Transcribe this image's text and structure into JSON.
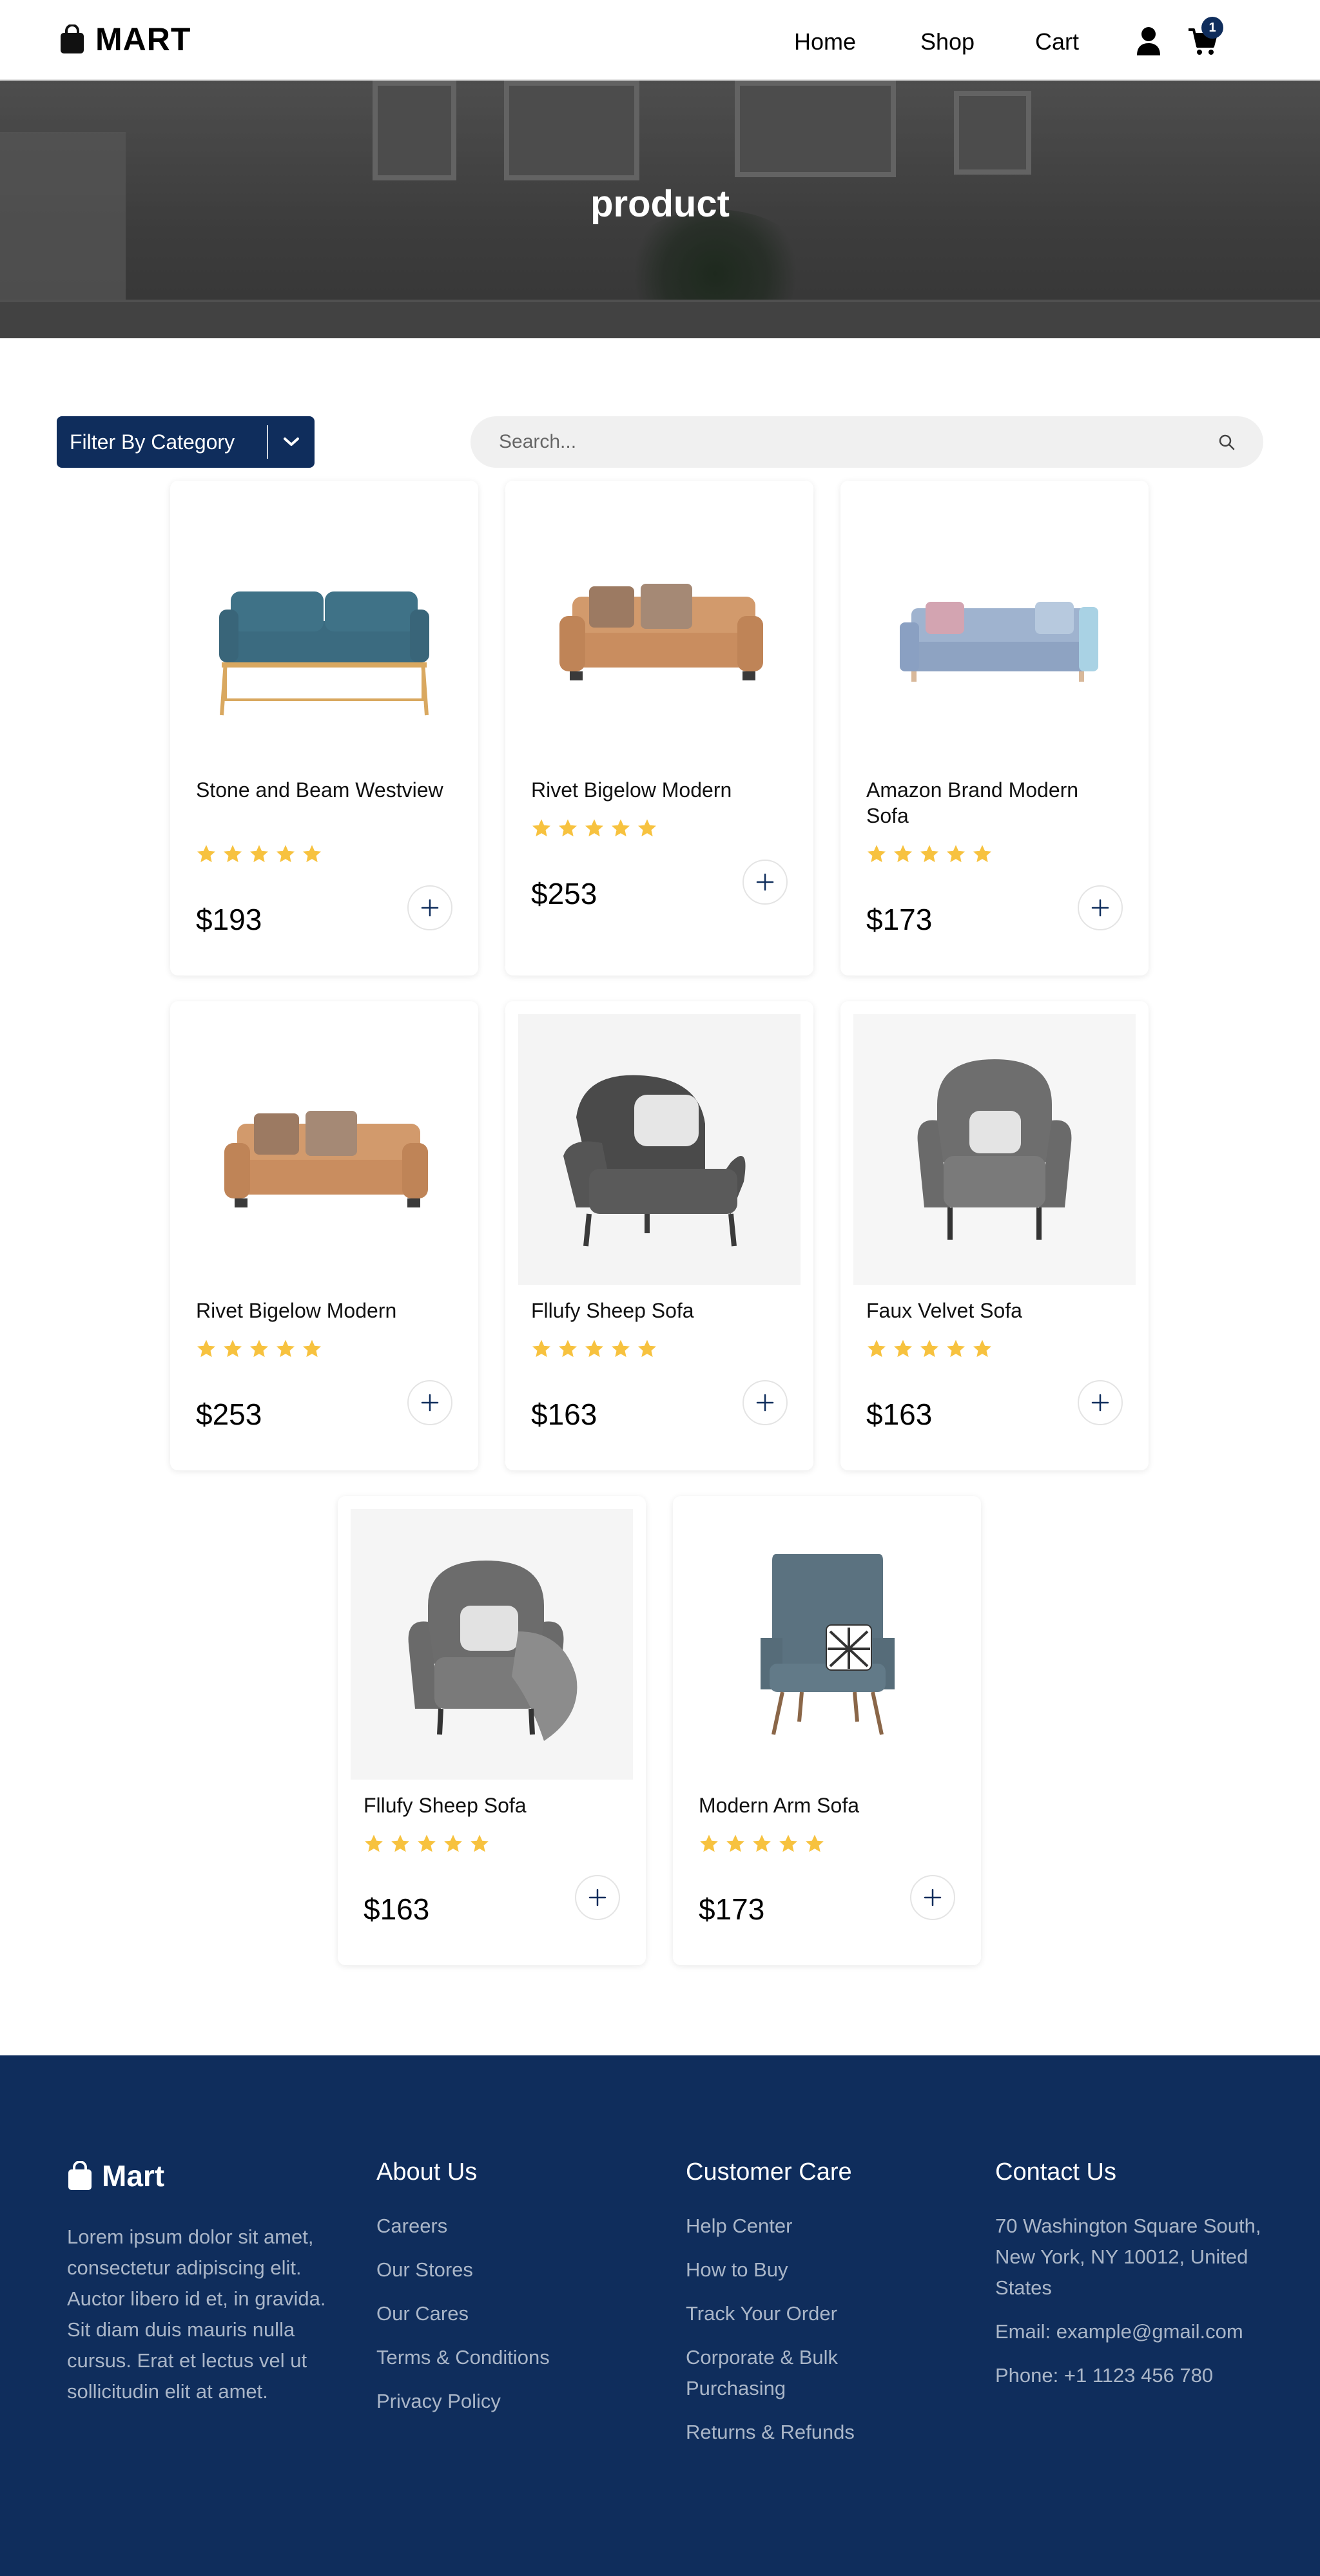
{
  "header": {
    "brand": "MART",
    "nav": {
      "home": "Home",
      "shop": "Shop",
      "cart": "Cart"
    },
    "cart_count": "1",
    "icons": [
      "shopping-bag-icon",
      "user-icon",
      "cart-icon"
    ]
  },
  "hero": {
    "title": "product"
  },
  "filter": {
    "label": "Filter By Category"
  },
  "search": {
    "placeholder": "Search..."
  },
  "products": [
    {
      "name": "Stone and Beam Westview",
      "price": "$193",
      "rating": 5
    },
    {
      "name": "Rivet Bigelow Modern",
      "price": "$253",
      "rating": 5
    },
    {
      "name": "Amazon Brand Modern Sofa",
      "price": "$173",
      "rating": 5
    },
    {
      "name": "Rivet Bigelow Modern",
      "price": "$253",
      "rating": 5
    },
    {
      "name": "Fllufy Sheep Sofa",
      "price": "$163",
      "rating": 5
    },
    {
      "name": "Faux Velvet Sofa",
      "price": "$163",
      "rating": 5
    },
    {
      "name": "Fllufy Sheep Sofa",
      "price": "$163",
      "rating": 5
    },
    {
      "name": "Modern Arm Sofa",
      "price": "$173",
      "rating": 5
    }
  ],
  "footer": {
    "brand": "Mart",
    "description": "Lorem ipsum dolor sit amet, consectetur adipiscing elit. Auctor libero id et, in gravida. Sit diam duis mauris nulla cursus. Erat et lectus vel ut sollicitudin elit at amet.",
    "about": {
      "title": "About Us",
      "links": [
        "Careers",
        "Our Stores",
        "Our Cares",
        "Terms & Conditions",
        "Privacy Policy"
      ]
    },
    "care": {
      "title": "Customer Care",
      "links": [
        "Help Center",
        "How to Buy",
        "Track Your Order",
        "Corporate & Bulk Purchasing",
        "Returns & Refunds"
      ]
    },
    "contact": {
      "title": "Contact Us",
      "address": "70 Washington Square South, New York, NY 10012, United States",
      "email": "Email: example@gmail.com",
      "phone": "Phone: +1 1123 456 780"
    }
  },
  "colors": {
    "primary": "#0f2d5c",
    "star": "#f7c23f",
    "footer_text": "#aab6c8"
  }
}
